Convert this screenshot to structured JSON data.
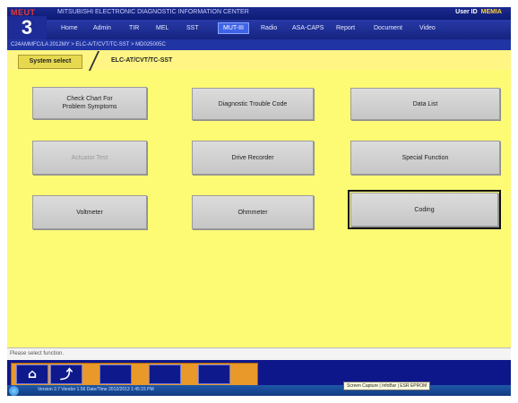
{
  "header": {
    "brand": "MEUT",
    "app_title": "MITSUBISHI ELECTRONIC DIAGNOSTIC INFORMATION CENTER",
    "user_label": "User ID",
    "user_value": "MEMIA",
    "big_number": "3"
  },
  "menu": [
    {
      "label": "Home"
    },
    {
      "label": "Admin"
    },
    {
      "label": "TIR"
    },
    {
      "label": "MEL"
    },
    {
      "label": "SST"
    },
    {
      "label": "MUT-III",
      "active": true
    },
    {
      "label": "Radio"
    },
    {
      "label": "ASA-CAPS"
    },
    {
      "label": "Report"
    },
    {
      "label": "Document"
    },
    {
      "label": "Video"
    }
  ],
  "path": "C24AMMFC/LA 2012MY  >  ELC-A/T/CVT/TC-SST  >  MD025005C",
  "tabs": {
    "system": "System select",
    "ecu": "ELC-AT/CVT/TC-SST"
  },
  "functions": [
    {
      "label": "Check Chart For\nProblem Symptoms",
      "enabled": true
    },
    {
      "label": "Diagnostic Trouble Code",
      "enabled": true
    },
    {
      "label": "Data List",
      "enabled": true
    },
    {
      "label": "Actuator Test",
      "enabled": false
    },
    {
      "label": "Drive Recorder",
      "enabled": true
    },
    {
      "label": "Special Function",
      "enabled": true
    },
    {
      "label": "Voltmeter",
      "enabled": true
    },
    {
      "label": "Ohmmeter",
      "enabled": true
    },
    {
      "label": "Coding",
      "enabled": true,
      "selected": true
    }
  ],
  "status": "Please select function.",
  "bottom_buttons": [
    {
      "icon": "home-icon",
      "glyph": "⌂"
    },
    {
      "icon": "back-icon",
      "glyph": "⤴"
    },
    {
      "icon": "empty-slot",
      "glyph": ""
    },
    {
      "icon": "empty-slot",
      "glyph": ""
    },
    {
      "icon": "empty-slot",
      "glyph": ""
    }
  ],
  "taskbar": {
    "version": "Version 2.7    Vendor 1.56    Date/Time 2012/2013 1:45:15 PM",
    "tooltip": "Screen Capture | InfoBar | ESR EPROM"
  },
  "colors": {
    "accent_blue": "#1b2a8e",
    "main_bg": "#fdfa74",
    "bottom_orange": "#e9982a"
  }
}
